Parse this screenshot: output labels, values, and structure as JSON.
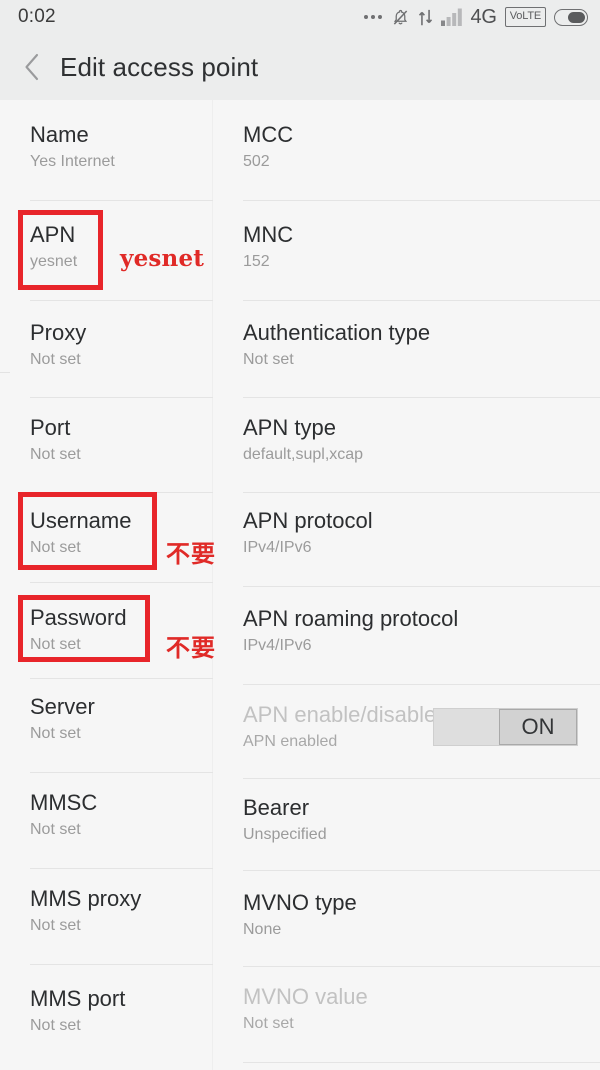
{
  "statusbar": {
    "time": "0:02",
    "icons": [
      "more-dots-icon",
      "silent-bell-icon",
      "data-transfer-icon",
      "signal-bars-icon"
    ],
    "network_label": "4G",
    "volte_label": "VoLTE",
    "battery_icon": "battery-icon"
  },
  "header": {
    "back_icon": "back-chevron-icon",
    "title": "Edit access point"
  },
  "left_column": [
    {
      "title": "Name",
      "value": "Yes Internet"
    },
    {
      "title": "APN",
      "value": "yesnet"
    },
    {
      "title": "Proxy",
      "value": "Not set"
    },
    {
      "title": "Port",
      "value": "Not set"
    },
    {
      "title": "Username",
      "value": "Not set"
    },
    {
      "title": "Password",
      "value": "Not set"
    },
    {
      "title": "Server",
      "value": "Not set"
    },
    {
      "title": "MMSC",
      "value": "Not set"
    },
    {
      "title": "MMS proxy",
      "value": "Not set"
    },
    {
      "title": "MMS port",
      "value": "Not set"
    }
  ],
  "right_column": [
    {
      "title": "MCC",
      "value": "502",
      "dim": false
    },
    {
      "title": "MNC",
      "value": "152",
      "dim": false
    },
    {
      "title": "Authentication type",
      "value": "Not set",
      "dim": false
    },
    {
      "title": "APN type",
      "value": "default,supl,xcap",
      "dim": false
    },
    {
      "title": "APN protocol",
      "value": "IPv4/IPv6",
      "dim": false
    },
    {
      "title": "APN roaming protocol",
      "value": "IPv4/IPv6",
      "dim": false
    },
    {
      "title": "APN enable/disable",
      "value": "APN enabled",
      "dim": true
    },
    {
      "title": "Bearer",
      "value": "Unspecified",
      "dim": false
    },
    {
      "title": "MVNO type",
      "value": "None",
      "dim": false
    },
    {
      "title": "MVNO value",
      "value": "Not set",
      "dim": true
    }
  ],
  "toggle": {
    "state_label": "ON"
  },
  "annotations": {
    "apn_label": "yesnet",
    "username_label": "不要",
    "password_label": "不要",
    "color": "#e02a27"
  }
}
